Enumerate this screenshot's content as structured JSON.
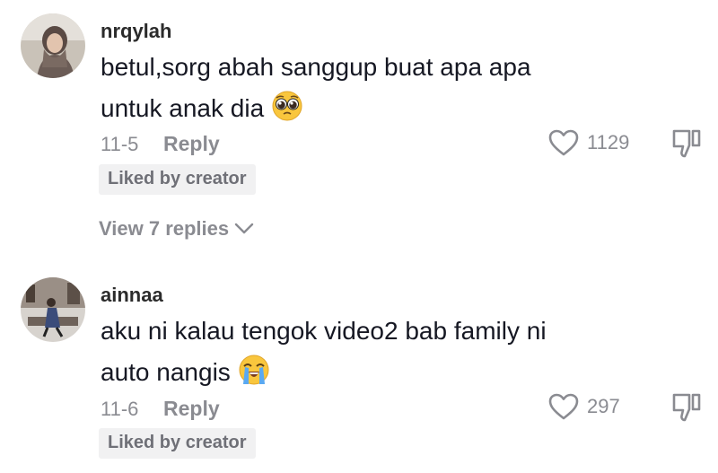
{
  "comments": [
    {
      "username": "nrqylah",
      "text_line1": "betul,sorg abah sanggup buat apa apa",
      "text_line2": "untuk anak dia",
      "emoji": "pleading-face-emoji",
      "date": "11-5",
      "reply_label": "Reply",
      "likes": "1129",
      "badge": "Liked by creator",
      "view_replies": "View 7 replies"
    },
    {
      "username": "ainnaa",
      "text_line1": "aku ni kalau tengok video2 bab family ni",
      "text_line2": "auto nangis",
      "emoji": "loudly-crying-face-emoji",
      "date": "11-6",
      "reply_label": "Reply",
      "likes": "297",
      "badge": "Liked by creator"
    }
  ],
  "icons": {
    "like": "heart-outline-icon",
    "dislike": "thumbs-down-icon",
    "expand": "chevron-down-icon"
  },
  "colors": {
    "text": "#161823",
    "secondary": "#8a8b91",
    "badge_bg": "#f1f1f2"
  }
}
